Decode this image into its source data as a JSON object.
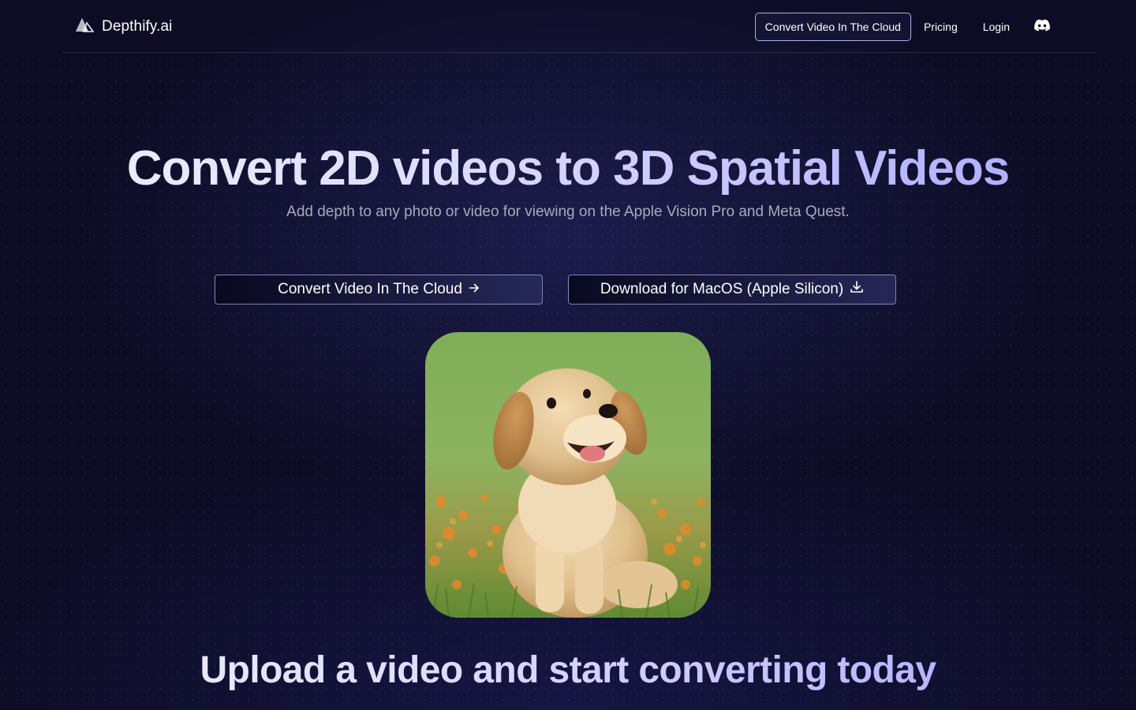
{
  "header": {
    "brand": "Depthify.ai",
    "nav": {
      "cta_label": "Convert Video In The Cloud",
      "pricing_label": "Pricing",
      "login_label": "Login"
    },
    "icons": {
      "logo": "mountain-logo-icon",
      "discord": "discord-icon"
    }
  },
  "hero": {
    "title": "Convert 2D videos to 3D Spatial Videos",
    "subtitle": "Add depth to any photo or video for viewing on the Apple Vision Pro and Meta Quest.",
    "buttons": {
      "cloud_label": "Convert Video In The Cloud",
      "mac_label": "Download for MacOS (Apple Silicon)"
    },
    "image_subject": "golden retriever puppy sitting in grass with orange flowers"
  },
  "section": {
    "title": "Upload a video and start converting today"
  },
  "colors": {
    "background": "#0d0c24",
    "accent": "#a9a5ff",
    "subtitle": "#a9a9bd"
  }
}
